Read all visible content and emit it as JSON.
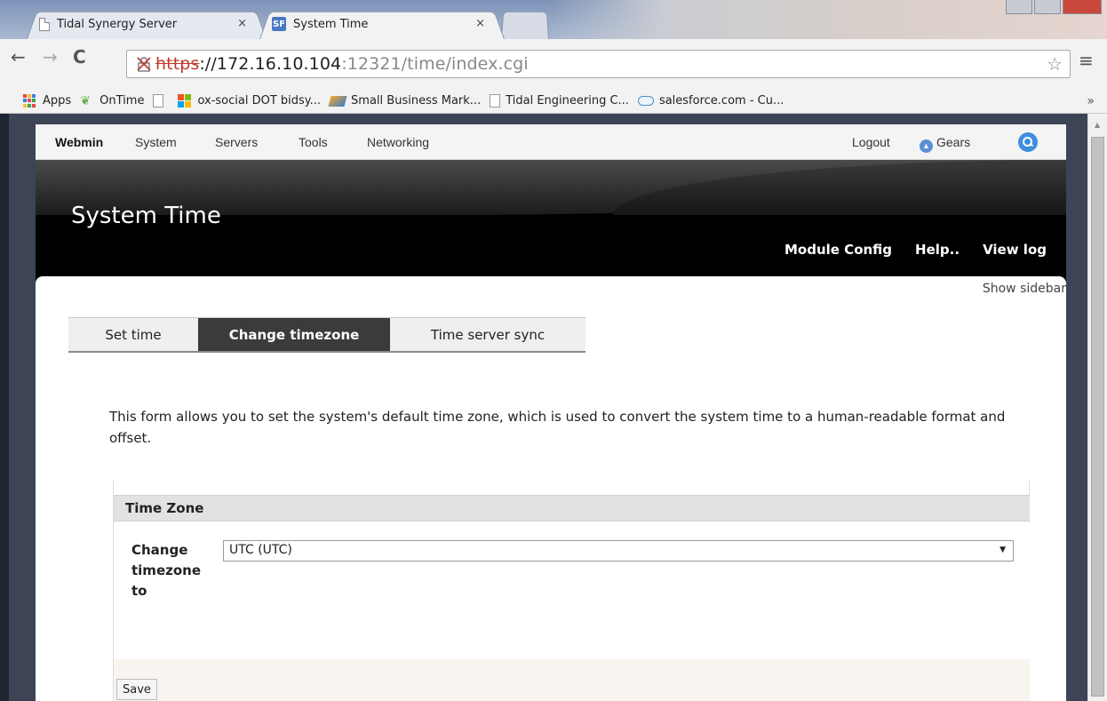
{
  "browser": {
    "tabs": [
      {
        "title": "Tidal Synergy Server",
        "close": "×"
      },
      {
        "title": "System Time",
        "close": "×",
        "favicon": "SF"
      }
    ],
    "url": {
      "scheme": "https",
      "rest_host": "://172.16.10.104",
      "rest_path": ":12321/time/index.cgi"
    },
    "bookmarks": [
      {
        "label": "Apps",
        "icon": "apps-grid-icon"
      },
      {
        "label": "OnTime",
        "icon": "leaf-icon"
      },
      {
        "label": "",
        "icon": "page-icon"
      },
      {
        "label": "ox-social DOT bidsy...",
        "icon": "windows-logo-icon"
      },
      {
        "label": "Small Business Mark...",
        "icon": "tag-icon"
      },
      {
        "label": "Tidal Engineering C...",
        "icon": "page-icon"
      },
      {
        "label": "salesforce.com - Cu...",
        "icon": "cloud-icon"
      }
    ],
    "more": "»"
  },
  "webmin": {
    "nav": {
      "brand": "Webmin",
      "items": [
        "System",
        "Servers",
        "Tools",
        "Networking"
      ],
      "logout": "Logout",
      "gears": "Gears"
    },
    "title": "System Time",
    "header_links": [
      "Module Config",
      "Help..",
      "View log"
    ],
    "show_sidebar": "Show sidebar",
    "tabs": [
      {
        "label": "Set time",
        "active": false
      },
      {
        "label": "Change timezone",
        "active": true
      },
      {
        "label": "Time server sync",
        "active": false
      }
    ],
    "description": "This form allows you to set the system's default time zone, which is used to convert the system time to a human-readable format and offset.",
    "panel": {
      "heading": "Time Zone",
      "field_label": "Change timezone to",
      "selected": "UTC (UTC)",
      "save": "Save"
    }
  },
  "colors": {
    "active_tab": "#3b3b3b",
    "header_bg": "#000000",
    "search_button": "#3d8fe0"
  }
}
